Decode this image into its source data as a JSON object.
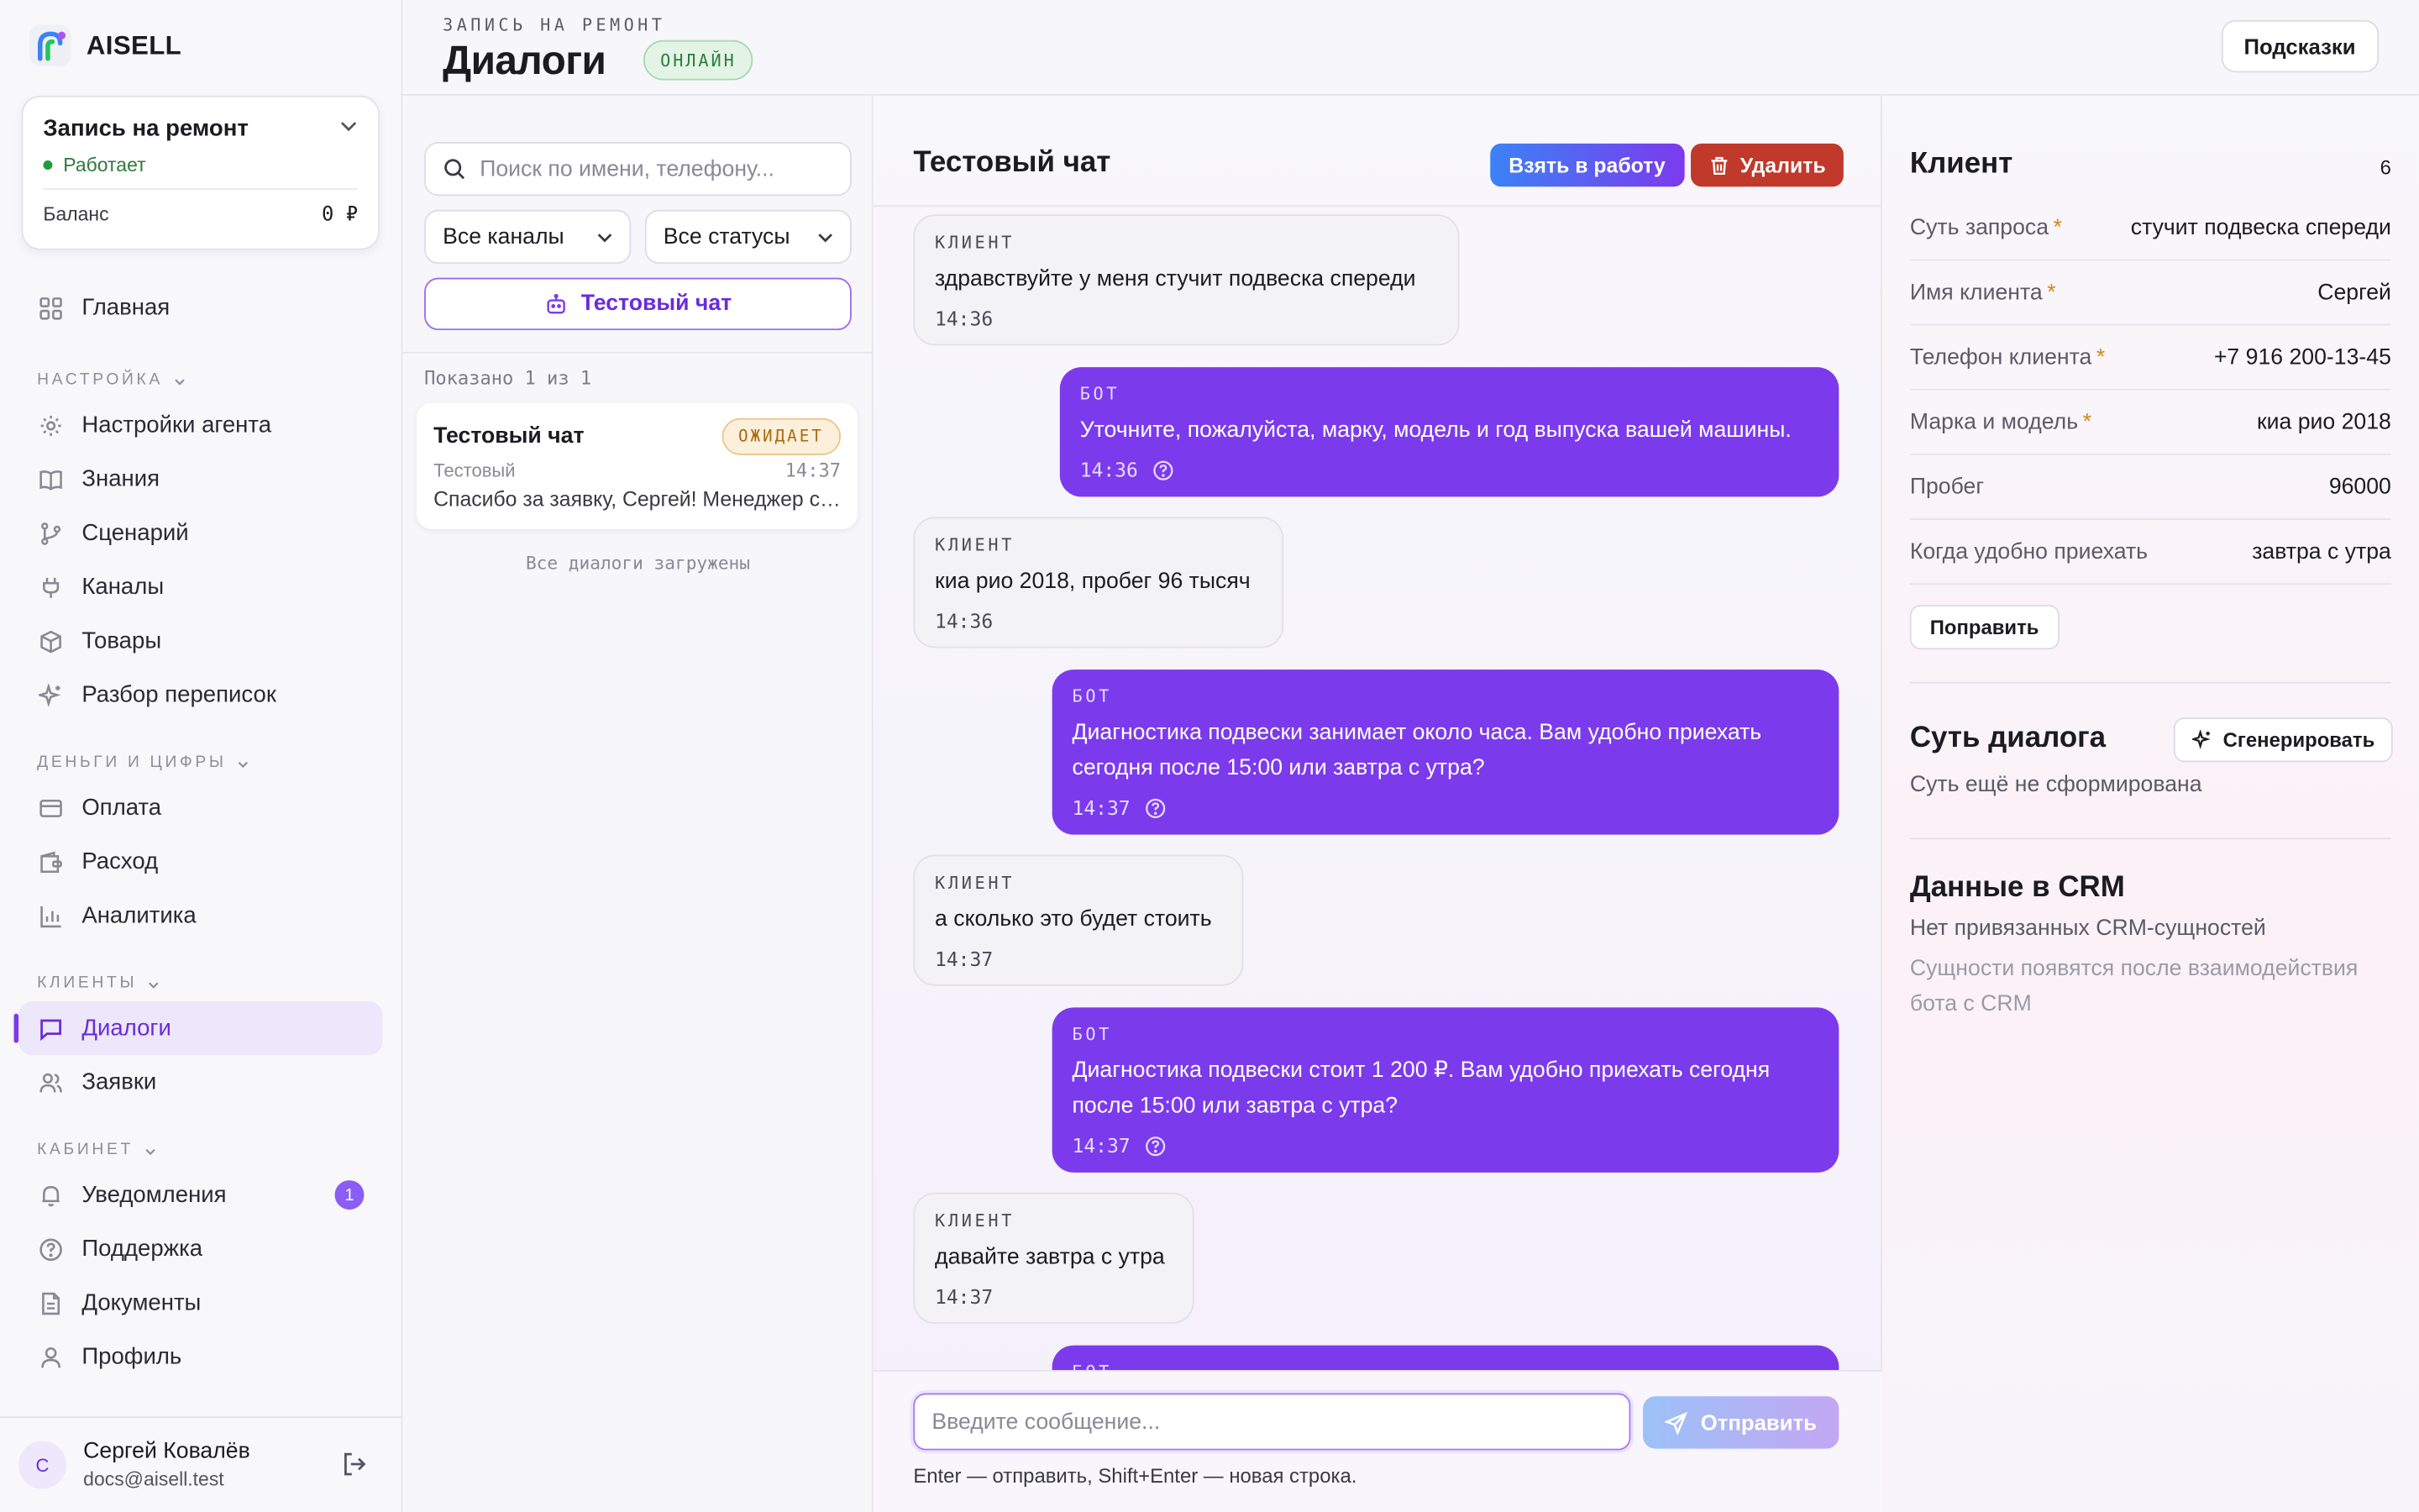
{
  "brand": {
    "name": "AISELL"
  },
  "workspace": {
    "name": "Запись на ремонт",
    "status": "Работает",
    "balance_label": "Баланс",
    "balance_value": "0 ₽"
  },
  "nav": {
    "home": "Главная",
    "section_settings": "НАСТРОЙКА",
    "agent_settings": "Настройки агента",
    "knowledge": "Знания",
    "scenario": "Сценарий",
    "channels": "Каналы",
    "products": "Товары",
    "review": "Разбор переписок",
    "section_money": "ДЕНЬГИ И ЦИФРЫ",
    "payment": "Оплата",
    "expense": "Расход",
    "analytics": "Аналитика",
    "section_clients": "КЛИЕНТЫ",
    "dialogs": "Диалоги",
    "requests": "Заявки",
    "section_cabinet": "КАБИНЕТ",
    "notifications": "Уведомления",
    "notifications_count": "1",
    "support": "Поддержка",
    "documents": "Документы",
    "profile": "Профиль"
  },
  "user": {
    "initial": "С",
    "name": "Сергей Ковалёв",
    "email": "docs@aisell.test"
  },
  "header": {
    "crumb": "ЗАПИСЬ НА РЕМОНТ",
    "title": "Диалоги",
    "badge": "ОНЛАЙН",
    "hints": "Подсказки"
  },
  "list": {
    "search_placeholder": "Поиск по имени, телефону...",
    "filter_channels": "Все каналы",
    "filter_statuses": "Все статусы",
    "test_chat_button": "Тестовый чат",
    "shown": "Показано 1 из 1",
    "card": {
      "name": "Тестовый чат",
      "status": "ОЖИДАЕТ",
      "channel": "Тестовый",
      "time": "14:37",
      "preview": "Спасибо за заявку, Сергей! Менеджер с вами свяжется."
    },
    "all_loaded": "Все диалоги загружены"
  },
  "chat": {
    "title": "Тестовый чат",
    "take_button": "Взять в работу",
    "delete_button": "Удалить",
    "messages": [
      {
        "role": "КЛИЕНТ",
        "text": "здравствуйте у меня стучит подвеска спереди",
        "time": "14:36"
      },
      {
        "role": "БОТ",
        "text": "Уточните, пожалуйста, марку, модель и год выпуска вашей машины.",
        "time": "14:36"
      },
      {
        "role": "КЛИЕНТ",
        "text": "киа рио 2018, пробег 96 тысяч",
        "time": "14:36"
      },
      {
        "role": "БОТ",
        "text": "Диагностика подвески занимает около часа. Вам удобно приехать сегодня после 15:00 или завтра с утра?",
        "time": "14:37"
      },
      {
        "role": "КЛИЕНТ",
        "text": "а сколько это будет стоить",
        "time": "14:37"
      },
      {
        "role": "БОТ",
        "text": "Диагностика подвески стоит 1 200 ₽. Вам удобно приехать сегодня после 15:00 или завтра с утра?",
        "time": "14:37"
      },
      {
        "role": "КЛИЕНТ",
        "text": "давайте завтра с утра",
        "time": "14:37"
      },
      {
        "role": "БОТ",
        "text": "",
        "time": ""
      }
    ],
    "input_placeholder": "Введите сообщение...",
    "send_button": "Отправить",
    "hint": "Enter — отправить, Shift+Enter — новая строка."
  },
  "client": {
    "title": "Клиент",
    "count": "6",
    "fields": [
      {
        "label": "Суть запроса",
        "required": "*",
        "value": "стучит подвеска спереди"
      },
      {
        "label": "Имя клиента",
        "required": "*",
        "value": "Сергей"
      },
      {
        "label": "Телефон клиента",
        "required": "*",
        "value": "+7 916 200-13-45"
      },
      {
        "label": "Марка и модель",
        "required": "*",
        "value": "киа рио 2018"
      },
      {
        "label": "Пробег",
        "required": "",
        "value": "96000"
      },
      {
        "label": "Когда удобно приехать",
        "required": "",
        "value": "завтра с утра"
      }
    ],
    "fix_button": "Поправить",
    "summary_title": "Суть диалога",
    "generate_button": "Сгенерировать",
    "summary_empty": "Суть ещё не сформирована",
    "crm_title": "Данные в CRM",
    "crm_empty": "Нет привязанных CRM-сущностей",
    "crm_note": "Сущности появятся после взаимодействия бота с CRM"
  }
}
